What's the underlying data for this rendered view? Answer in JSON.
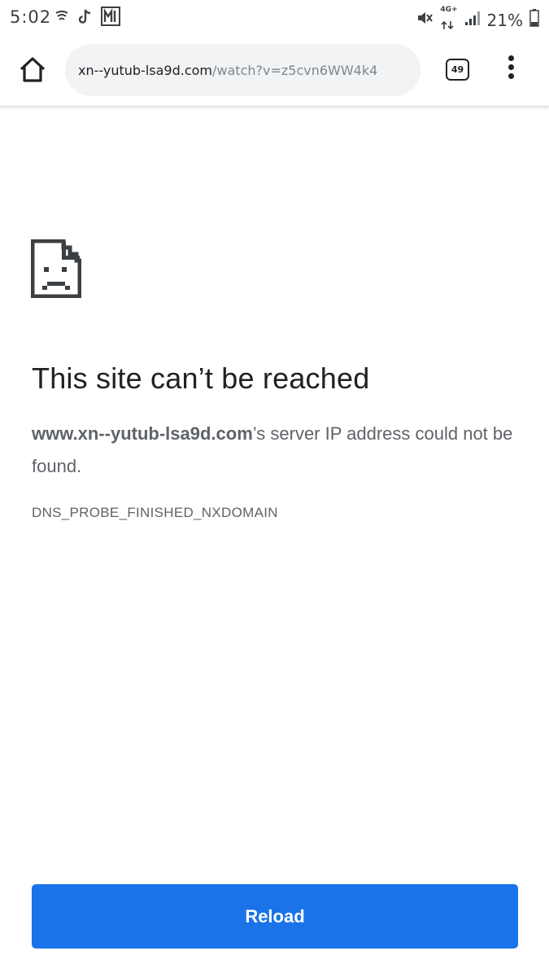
{
  "status_bar": {
    "time": "5:02",
    "left_icons": [
      "notification-icon",
      "tiktok-icon",
      "app-m-icon"
    ],
    "network_label": "4G+",
    "battery": "21%",
    "right_icons": [
      "vibrate-mute-icon",
      "network-4g-icon",
      "signal-icon",
      "battery-icon"
    ]
  },
  "toolbar": {
    "url_domain": "xn--yutub-lsa9d.com",
    "url_path": "/watch?v=z5cvn6WW4k4",
    "tab_count": "49",
    "icons": [
      "home-icon",
      "more-vert-icon"
    ]
  },
  "error": {
    "icon": "sad-document-icon",
    "title": "This site can’t be reached",
    "host": "www.xn--yutub-lsa9d.com",
    "message": "’s server IP address could not be found.",
    "code": "DNS_PROBE_FINISHED_NXDOMAIN"
  },
  "actions": {
    "reload_label": "Reload"
  },
  "colors": {
    "accent": "#1a73e8",
    "text": "#202124",
    "secondary_text": "#5f6368",
    "url_bar_bg": "#f1f3f4"
  }
}
